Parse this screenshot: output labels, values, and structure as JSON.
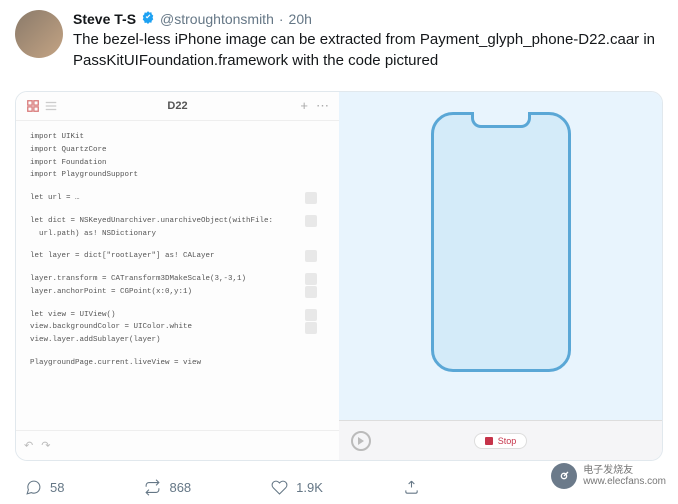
{
  "tweet": {
    "displayName": "Steve T-S",
    "handle": "@stroughtonsmith",
    "time": "20h",
    "text": "The bezel-less iPhone image can be extracted from Payment_glyph_phone-D22.caar in PassKitUIFoundation.framework with the code pictured"
  },
  "editor": {
    "title": "D22",
    "code": {
      "imports": [
        "import UIKit",
        "import QuartzCore",
        "import Foundation",
        "import PlaygroundSupport"
      ],
      "url": "let url = …",
      "dict": "let dict = NSKeyedUnarchiver.unarchiveObject(withFile:\n  url.path) as! NSDictionary",
      "layer": "let layer = dict[\"rootLayer\"] as! CALayer",
      "transforms": [
        "layer.transform = CATransform3DMakeScale(3,-3,1)",
        "layer.anchorPoint = CGPoint(x:0,y:1)"
      ],
      "view": [
        "let view = UIView()",
        "view.backgroundColor = UIColor.white",
        "view.layer.addSublayer(layer)"
      ],
      "playground": "PlaygroundPage.current.liveView = view"
    },
    "stopLabel": "Stop"
  },
  "actions": {
    "replies": "58",
    "retweets": "868",
    "likes": "1.9K"
  },
  "watermark": {
    "line1": "电子发烧友",
    "line2": "www.elecfans.com"
  }
}
